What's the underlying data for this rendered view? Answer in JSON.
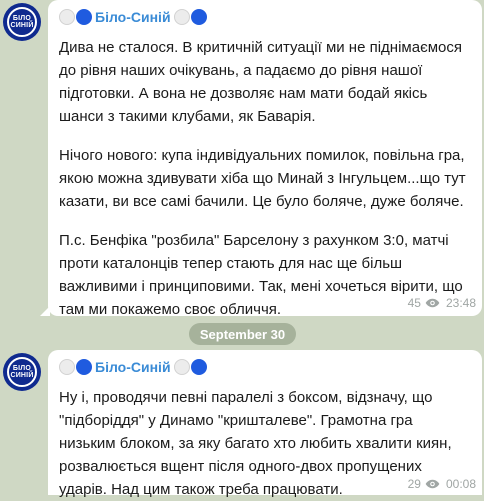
{
  "messages": [
    {
      "avatar": {
        "line1": "БІЛО",
        "line2": "СИНІЙ"
      },
      "channel_name": "Біло-Синій",
      "paragraphs": [
        "Дива не сталося. В критичній ситуації ми не піднімаємося до рівня наших очікувань, а падаємо до рівня нашої підготовки. А вона не дозволяє нам мати бодай якісь шанси з такими клубами, як Баварія.",
        "Нічого нового: купа індивідуальних помилок, повільна гра, якою можна здивувати хіба що Минай з Інгульцем...що тут казати, ви все самі бачили. Це було боляче, дуже боляче.",
        "П.с. Бенфіка \"розбила\" Барселону з рахунком 3:0, матчі проти каталонців тепер стають для нас ще більш важливими і принциповими. Так, мені хочеться вірити, що там ми покажемо своє обличчя."
      ],
      "views": "45",
      "time": "23:48"
    },
    {
      "avatar": {
        "line1": "БІЛО",
        "line2": "СИНІЙ"
      },
      "channel_name": "Біло-Синій",
      "paragraphs": [
        "Ну і, проводячи певні паралелі з боксом, відзначу, що \"підборіддя\" у Динамо \"кришталеве\". Грамотна гра низьким блоком, за яку багато хто любить хвалити киян, розвалюється вщент після одного-двох пропущених ударів. Над цим також треба працювати."
      ],
      "views": "29",
      "time": "00:08"
    }
  ],
  "date_separator": "September 30",
  "colors": {
    "background": "#cfd8c4",
    "bubble": "#ffffff",
    "channel_name": "#3a8bd6",
    "flag_blue": "#1f5bdf",
    "avatar_bg": "#0f2a8f"
  },
  "icons": [
    "white-circle-icon",
    "blue-circle-icon",
    "eye-icon"
  ]
}
